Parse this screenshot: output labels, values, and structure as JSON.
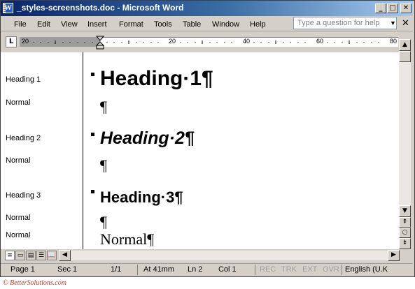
{
  "window": {
    "title": "_styles-screenshots.doc - Microsoft Word",
    "app_icon_glyph": "W",
    "buttons": {
      "minimize": "_",
      "maximize": "□",
      "close": "✕"
    }
  },
  "menu": {
    "items": [
      "File",
      "Edit",
      "View",
      "Insert",
      "Format",
      "Tools",
      "Table",
      "Window",
      "Help"
    ],
    "ask_placeholder": "Type a question for help",
    "ask_arrow": "▼",
    "close_doc": "✕"
  },
  "ruler": {
    "tab_selector": "L",
    "numbers": [
      "20",
      "20",
      "40",
      "60",
      "80"
    ]
  },
  "style_area": {
    "labels": [
      "Heading 1",
      "Normal",
      "Heading 2",
      "Normal",
      "Heading 3",
      "Normal",
      "Normal"
    ]
  },
  "document": {
    "heading1": "Heading·1¶",
    "heading2": "Heading·2¶",
    "heading3": "Heading·3¶",
    "para_mark": "¶",
    "normal": "Normal¶"
  },
  "scrollbar": {
    "up": "▲",
    "down": "▼",
    "prev": "⇞",
    "select": "○",
    "next": "⇟"
  },
  "view_buttons": [
    "≡",
    "▭",
    "▤",
    "☰",
    "📖"
  ],
  "status": {
    "page": "Page  1",
    "sec": "Sec  1",
    "pages": "1/1",
    "at": "At  41mm",
    "ln": "Ln  2",
    "col": "Col  1",
    "rec": "REC",
    "trk": "TRK",
    "ext": "EXT",
    "ovr": "OVR",
    "lang": "English (U.K"
  },
  "copyright": "© BetterSolutions.com",
  "colors": {
    "title_start": "#0a246a",
    "title_end": "#a6caf0",
    "chrome": "#d4d0c8",
    "copyright": "#c0392b"
  }
}
